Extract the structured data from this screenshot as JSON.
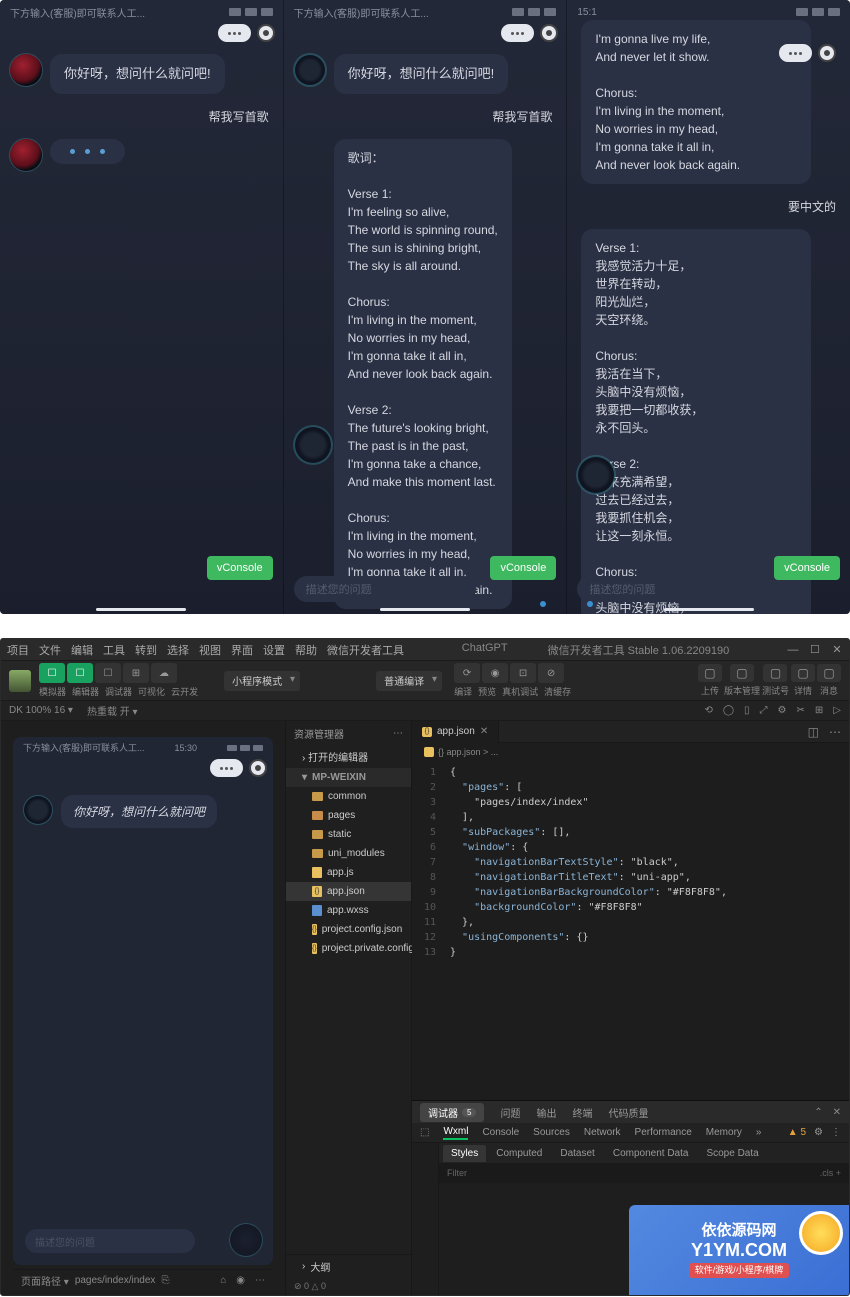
{
  "phones": {
    "status_hint": "下方输入(客服)即可联系人工...",
    "time": "15:1",
    "greeting": "你好呀，想问什么就问吧!",
    "user_prompt": "帮我写首歌",
    "vconsole": "vConsole",
    "input_placeholder": "描述您的问题",
    "lyrics_zh_header": "歌词：",
    "lyrics_en_v1": "Verse 1:\nI'm feeling so alive,\nThe world is spinning round,\nThe sun is shining bright,\nThe sky is all around.",
    "lyrics_en_ch": "Chorus:\nI'm living in the moment,\nNo worries in my head,\nI'm gonna take it all in,\nAnd never look back again.",
    "lyrics_en_v2": "Verse 2:\nThe future's looking bright,\nThe past is in the past,\nI'm gonna take a chance,\nAnd make this moment last.",
    "lyrics_en_top": "I'm gonna live my life,\nAnd never let it show.",
    "user_prompt_cn": "要中文的",
    "lyrics_cn_v1": "Verse 1:\n我感觉活力十足，\n世界在转动，\n阳光灿烂，\n天空环绕。",
    "lyrics_cn_ch": "Chorus:\n我活在当下，\n头脑中没有烦恼，\n我要把一切都收获，\n永不回头。",
    "lyrics_cn_v2": "Verse 2:\n未来充满希望，\n过去已经过去，\n我要抓住机会，\n让这一刻永恒。"
  },
  "ide": {
    "menus": [
      "项目",
      "文件",
      "编辑",
      "工具",
      "转到",
      "选择",
      "视图",
      "界面",
      "设置",
      "帮助",
      "微信开发者工具"
    ],
    "title_center": [
      "ChatGPT",
      "微信开发者工具 Stable 1.06.2209190"
    ],
    "toolbar": {
      "row1_labels": [
        "模拟器",
        "编辑器",
        "调试器",
        "可视化",
        "云开发"
      ],
      "mode_select": "小程序模式",
      "compile_select": "普通编译",
      "mid_labels": [
        "编译",
        "预览",
        "真机调试",
        "清缓存"
      ],
      "right_labels": [
        "上传",
        "版本管理",
        "测试号",
        "详情",
        "消息"
      ]
    },
    "status_strip": {
      "left": "DK 100% 16 ▾",
      "hot": "热重载 开 ▾"
    },
    "simulator": {
      "hint": "下方输入(客服)即可联系人工...",
      "time": "15:30",
      "greeting": "你好呀，想问什么就问吧",
      "placeholder": "描述您的问题",
      "footer_path": "页面路径 ▾",
      "footer_page": "pages/index/index"
    },
    "explorer": {
      "title": "资源管理器",
      "open_editors": "› 打开的编辑器",
      "project": "MP-WEIXIN",
      "items": [
        {
          "type": "folder",
          "label": "common"
        },
        {
          "type": "folder",
          "label": "pages",
          "orange": true
        },
        {
          "type": "folder",
          "label": "static"
        },
        {
          "type": "folder",
          "label": "uni_modules"
        },
        {
          "type": "js",
          "label": "app.js"
        },
        {
          "type": "json",
          "label": "app.json",
          "selected": true
        },
        {
          "type": "wxss",
          "label": "app.wxss"
        },
        {
          "type": "json",
          "label": "project.config.json"
        },
        {
          "type": "json",
          "label": "project.private.config.js..."
        }
      ],
      "outline": "大纲",
      "problems": "⊘ 0 △ 0"
    },
    "editor": {
      "tab_name": "app.json",
      "breadcrumb": "{} app.json > ...",
      "code_lines": [
        {
          "n": 1,
          "t": "{"
        },
        {
          "n": 2,
          "t": "  \"pages\": ["
        },
        {
          "n": 3,
          "t": "    \"pages/index/index\""
        },
        {
          "n": 4,
          "t": "  ],"
        },
        {
          "n": 5,
          "t": "  \"subPackages\": [],"
        },
        {
          "n": 6,
          "t": "  \"window\": {"
        },
        {
          "n": 7,
          "t": "    \"navigationBarTextStyle\": \"black\","
        },
        {
          "n": 8,
          "t": "    \"navigationBarTitleText\": \"uni-app\","
        },
        {
          "n": 9,
          "t": "    \"navigationBarBackgroundColor\": \"#F8F8F8\","
        },
        {
          "n": 10,
          "t": "    \"backgroundColor\": \"#F8F8F8\""
        },
        {
          "n": 11,
          "t": "  },"
        },
        {
          "n": 12,
          "t": "  \"usingComponents\": {}"
        },
        {
          "n": 13,
          "t": "}"
        }
      ]
    },
    "devtools": {
      "row1": [
        "调试器",
        "问题",
        "输出",
        "终端",
        "代码质量"
      ],
      "row1_badge": "5",
      "row2": [
        "Wxml",
        "Console",
        "Sources",
        "Network",
        "Performance",
        "Memory"
      ],
      "row2_warn": "▲ 5",
      "styles_tabs": [
        "Styles",
        "Computed",
        "Dataset",
        "Component Data",
        "Scope Data"
      ],
      "filter": "Filter",
      "cls": ".cls"
    },
    "watermark": {
      "line1": "依依源码网",
      "line2": "Y1YM.COM",
      "sub": "软件/游戏/小程序/棋牌"
    }
  }
}
